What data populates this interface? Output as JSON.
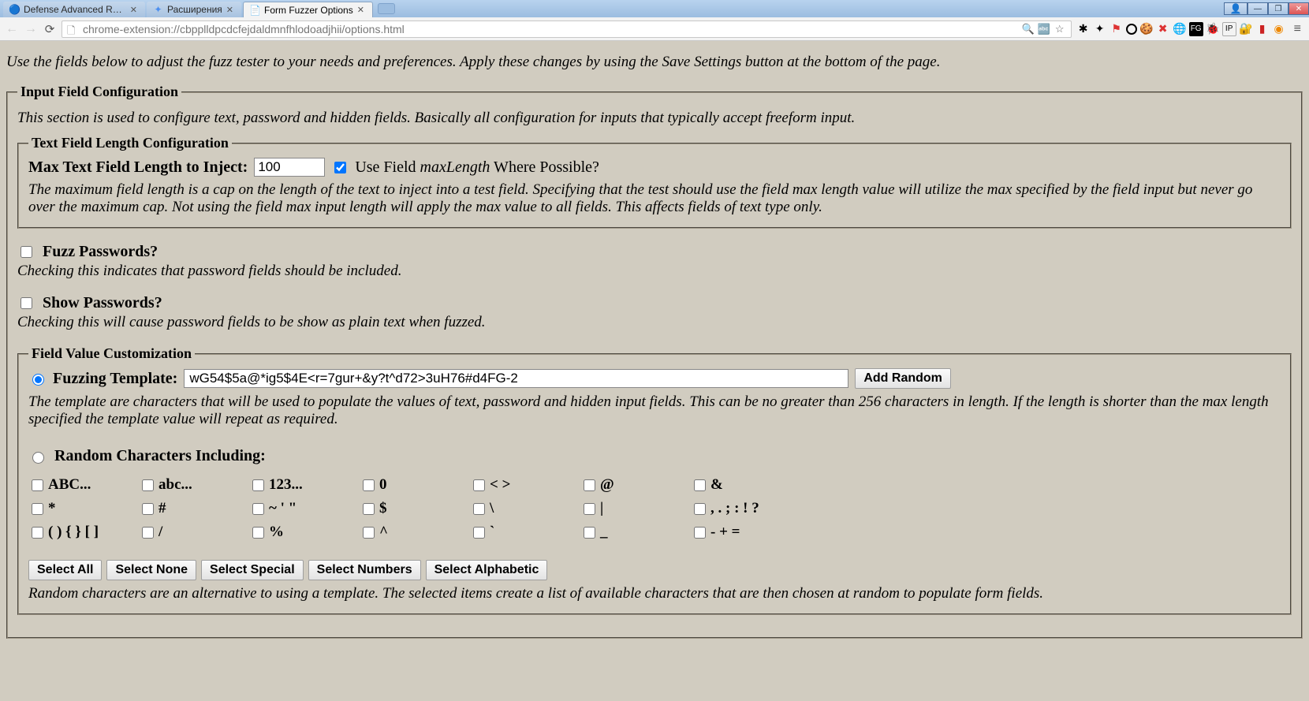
{
  "browser": {
    "tabs": [
      {
        "title": "Defense Advanced Resear"
      },
      {
        "title": "Расширения"
      },
      {
        "title": "Form Fuzzer Options"
      }
    ],
    "url": "chrome-extension://cbpplldpcdcfejdaldmnfhlodoadjhii/options.html"
  },
  "intro": "Use the fields below to adjust the fuzz tester to your needs and preferences. Apply these changes by using the Save Settings button at the bottom of the page.",
  "input_cfg": {
    "legend": "Input Field Configuration",
    "desc": "This section is used to configure text, password and hidden fields. Basically all configuration for inputs that typically accept freeform input.",
    "length_cfg": {
      "legend": "Text Field Length Configuration",
      "max_label": "Max Text Field Length to Inject:",
      "max_value": "100",
      "use_maxlength_checked": true,
      "use_label_pre": "Use Field ",
      "use_label_em": "maxLength",
      "use_label_post": " Where Possible?",
      "help": "The maximum field length is a cap on the length of the text to inject into a test field. Specifying that the test should use the field max length value will utilize the max specified by the field input but never go over the maximum cap. Not using the field max input length will apply the max value to all fields. This affects fields of text type only."
    },
    "fuzz_pw": {
      "label": "Fuzz Passwords?",
      "desc": "Checking this indicates that password fields should be included."
    },
    "show_pw": {
      "label": "Show Passwords?",
      "desc": "Checking this will cause password fields to be show as plain text when fuzzed."
    },
    "value_custom": {
      "legend": "Field Value Customization",
      "template_label": "Fuzzing Template:",
      "template_value": "wG54$5a@*ig5$4E<r=7gur+&y?t^d72>3uH76#d4FG-2",
      "add_random": "Add Random",
      "template_help": "The template are characters that will be used to populate the values of text, password and hidden input fields. This can be no greater than 256 characters in length. If the length is shorter than the max length specified the template value will repeat as required.",
      "random_label": "Random Characters Including:",
      "chars": {
        "r1": [
          "ABC...",
          "abc...",
          "123...",
          "0",
          "< >",
          "@",
          "&"
        ],
        "r2": [
          "*",
          "#",
          "~ ' \"",
          "$",
          "\\",
          "|",
          ", . ; : ! ?"
        ],
        "r3": [
          "( ) { } [ ]",
          "/",
          "%",
          "^",
          "`",
          "_",
          "- + ="
        ]
      },
      "buttons": {
        "all": "Select All",
        "none": "Select None",
        "special": "Select Special",
        "numbers": "Select Numbers",
        "alpha": "Select Alphabetic"
      },
      "random_help": "Random characters are an alternative to using a template. The selected items create a list of available characters that are then chosen at random to populate form fields."
    }
  }
}
